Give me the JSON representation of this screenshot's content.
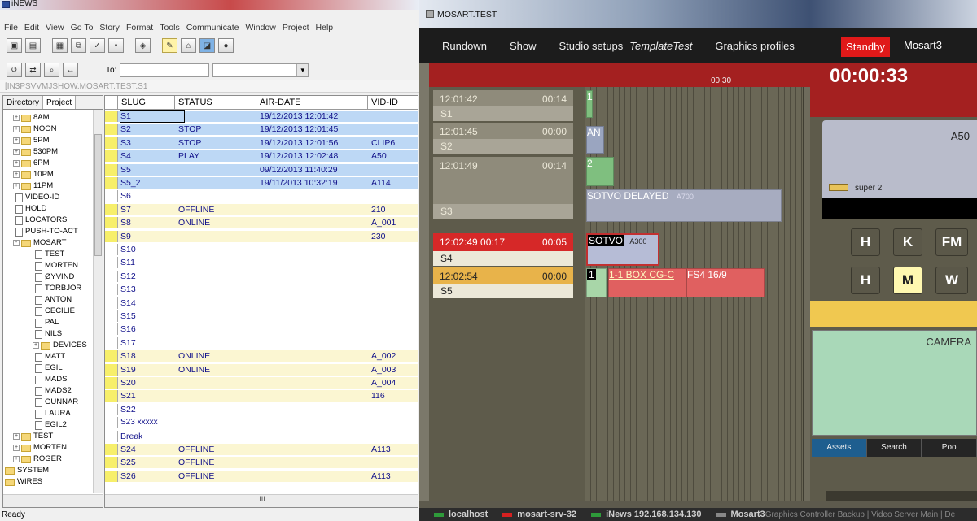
{
  "inews": {
    "title": "iNEWS",
    "menu": [
      "File",
      "Edit",
      "View",
      "Go To",
      "Story",
      "Format",
      "Tools",
      "Communicate",
      "Window",
      "Project",
      "Help"
    ],
    "to_label": "To:",
    "path": "[IN3PSVVMJSHOW.MOSART.TEST.S1",
    "tabs": [
      "Directory",
      "Project"
    ],
    "tree": [
      {
        "label": "8AM",
        "type": "folder",
        "level": 0,
        "expand": "+"
      },
      {
        "label": "NOON",
        "type": "folder",
        "level": 0,
        "expand": "+"
      },
      {
        "label": "5PM",
        "type": "folder",
        "level": 0,
        "expand": "+"
      },
      {
        "label": "530PM",
        "type": "folder",
        "level": 0,
        "expand": "+"
      },
      {
        "label": "6PM",
        "type": "folder",
        "level": 0,
        "expand": "+"
      },
      {
        "label": "10PM",
        "type": "folder",
        "level": 0,
        "expand": "+"
      },
      {
        "label": "11PM",
        "type": "folder",
        "level": 0,
        "expand": "+"
      },
      {
        "label": "VIDEO-ID",
        "type": "doc",
        "level": 0
      },
      {
        "label": "HOLD",
        "type": "doc",
        "level": 0
      },
      {
        "label": "LOCATORS",
        "type": "doc",
        "level": 0
      },
      {
        "label": "PUSH-TO-ACT",
        "type": "doc",
        "level": 0
      },
      {
        "label": "MOSART",
        "type": "folder",
        "level": 0,
        "expand": "-"
      },
      {
        "label": "TEST",
        "type": "doc",
        "level": 1
      },
      {
        "label": "MORTEN",
        "type": "doc",
        "level": 1
      },
      {
        "label": "ØYVIND",
        "type": "doc",
        "level": 1
      },
      {
        "label": "TORBJOR",
        "type": "doc",
        "level": 1
      },
      {
        "label": "ANTON",
        "type": "doc",
        "level": 1
      },
      {
        "label": "CECILIE",
        "type": "doc",
        "level": 1
      },
      {
        "label": "PAL",
        "type": "doc",
        "level": 1
      },
      {
        "label": "NILS",
        "type": "doc",
        "level": 1
      },
      {
        "label": "DEVICES",
        "type": "folder",
        "level": 1,
        "expand": "+"
      },
      {
        "label": "MATT",
        "type": "doc",
        "level": 1
      },
      {
        "label": "EGIL",
        "type": "doc",
        "level": 1
      },
      {
        "label": "MADS",
        "type": "doc",
        "level": 1
      },
      {
        "label": "MADS2",
        "type": "doc",
        "level": 1
      },
      {
        "label": "GUNNAR",
        "type": "doc",
        "level": 1
      },
      {
        "label": "LAURA",
        "type": "doc",
        "level": 1
      },
      {
        "label": "EGIL2",
        "type": "doc",
        "level": 1
      },
      {
        "label": "TEST",
        "type": "folder",
        "level": 0,
        "expand": "+"
      },
      {
        "label": "MORTEN",
        "type": "folder",
        "level": 0,
        "expand": "+"
      },
      {
        "label": "ROGER",
        "type": "folder",
        "level": 0,
        "expand": "+"
      },
      {
        "label": "SYSTEM",
        "type": "folder",
        "level": -1
      },
      {
        "label": "WIRES",
        "type": "folder",
        "level": -1
      }
    ],
    "columns": [
      "SLUG",
      "STATUS",
      "AIR-DATE",
      "VID-ID"
    ],
    "rows": [
      {
        "slug": "S1",
        "status": "",
        "air": "19/12/2013 12:01:42",
        "vid": "",
        "bg": "blue"
      },
      {
        "slug": "S2",
        "status": "STOP",
        "air": "19/12/2013 12:01:45",
        "vid": "",
        "bg": "blue"
      },
      {
        "slug": "S3",
        "status": "STOP",
        "air": "19/12/2013 12:01:56",
        "vid": "CLIP6",
        "bg": "blue"
      },
      {
        "slug": "S4",
        "status": "PLAY",
        "air": "19/12/2013 12:02:48",
        "vid": "A50",
        "bg": "blue"
      },
      {
        "slug": "S5",
        "status": "",
        "air": "09/12/2013 11:40:29",
        "vid": "",
        "bg": "blue"
      },
      {
        "slug": "S5_2",
        "status": "",
        "air": "19/11/2013 10:32:19",
        "vid": "A114",
        "bg": "blue"
      },
      {
        "slug": "S6",
        "status": "",
        "air": "",
        "vid": "",
        "bg": "white"
      },
      {
        "slug": "S7",
        "status": "OFFLINE",
        "air": "",
        "vid": "210",
        "bg": "yellow"
      },
      {
        "slug": "S8",
        "status": "ONLINE",
        "air": "",
        "vid": "A_001",
        "bg": "yellow"
      },
      {
        "slug": "S9",
        "status": "",
        "air": "",
        "vid": "230",
        "bg": "yellow"
      },
      {
        "slug": "S10",
        "status": "",
        "air": "",
        "vid": "",
        "bg": "white"
      },
      {
        "slug": "S11",
        "status": "",
        "air": "",
        "vid": "",
        "bg": "white"
      },
      {
        "slug": "S12",
        "status": "",
        "air": "",
        "vid": "",
        "bg": "white"
      },
      {
        "slug": "S13",
        "status": "",
        "air": "",
        "vid": "",
        "bg": "white"
      },
      {
        "slug": "S14",
        "status": "",
        "air": "",
        "vid": "",
        "bg": "white"
      },
      {
        "slug": "S15",
        "status": "",
        "air": "",
        "vid": "",
        "bg": "white"
      },
      {
        "slug": "S16",
        "status": "",
        "air": "",
        "vid": "",
        "bg": "white"
      },
      {
        "slug": "S17",
        "status": "",
        "air": "",
        "vid": "",
        "bg": "white"
      },
      {
        "slug": "S18",
        "status": "ONLINE",
        "air": "",
        "vid": "A_002",
        "bg": "yellow"
      },
      {
        "slug": "S19",
        "status": "ONLINE",
        "air": "",
        "vid": "A_003",
        "bg": "yellow"
      },
      {
        "slug": "S20",
        "status": "",
        "air": "",
        "vid": "A_004",
        "bg": "yellow"
      },
      {
        "slug": "S21",
        "status": "",
        "air": "",
        "vid": "116",
        "bg": "yellow"
      },
      {
        "slug": "S22",
        "status": "",
        "air": "",
        "vid": "",
        "bg": "white"
      },
      {
        "slug": "S23 xxxxx",
        "status": "",
        "air": "",
        "vid": "",
        "bg": "white"
      },
      {
        "slug": "Break",
        "status": "",
        "air": "",
        "vid": "",
        "bg": "white"
      },
      {
        "slug": "S24",
        "status": "OFFLINE",
        "air": "",
        "vid": "A113",
        "bg": "yellow"
      },
      {
        "slug": "S25",
        "status": "OFFLINE",
        "air": "",
        "vid": "",
        "bg": "yellow"
      },
      {
        "slug": "S26",
        "status": "OFFLINE",
        "air": "",
        "vid": "A113",
        "bg": "yellow"
      }
    ],
    "scroll_glyph": "III",
    "status": "Ready"
  },
  "mosart": {
    "title": "MOSART.TEST",
    "menu": [
      "Rundown",
      "Show",
      "Studio setups",
      "TemplateTest",
      "Graphics profiles"
    ],
    "standby": "Standby",
    "mosart3": "Mosart3",
    "timecode": "00:30",
    "timer": "00:00:33",
    "stories": [
      {
        "time": "12:01:42",
        "dur": "00:14",
        "slug": "S1",
        "state": "normal"
      },
      {
        "time": "12:01:45",
        "dur": "00:00",
        "slug": "S2",
        "state": "normal"
      },
      {
        "time": "12:01:49",
        "dur": "00:14",
        "slug": "S3",
        "state": "normal"
      },
      {
        "time": "12:02:49  00:17",
        "dur": "00:05",
        "slug": "S4",
        "state": "onair"
      },
      {
        "time": "12:02:54",
        "dur": "00:00",
        "slug": "S5",
        "state": "next"
      }
    ],
    "blocks": {
      "an": "AN",
      "sotvo_delayed": "SOTVO DELAYED",
      "a700": "A700",
      "sotvo": "SOTVO",
      "a300": "A300",
      "box": "1-1 BOX CG-C",
      "fs4": "FS4 16/9",
      "n1": "1",
      "n2": "2"
    },
    "preview_label": "A50",
    "super_label": "super 2",
    "keys_row1": [
      "H",
      "K",
      "FM"
    ],
    "keys_row2": [
      "H",
      "M",
      "W"
    ],
    "camera_label": "CAMERA",
    "asset_tabs": [
      "Assets",
      "Search",
      "Poo"
    ],
    "status": [
      {
        "label": "localhost",
        "color": "#2e9a3a"
      },
      {
        "label": "mosart-srv-32",
        "color": "#d62020"
      },
      {
        "label": "iNews 192.168.134.130",
        "color": "#2e9a3a"
      },
      {
        "label": "Mosart3",
        "color": "#888888"
      }
    ],
    "status_tail": "Graphics Controller Backup  |  Video Server Main  |  De"
  }
}
